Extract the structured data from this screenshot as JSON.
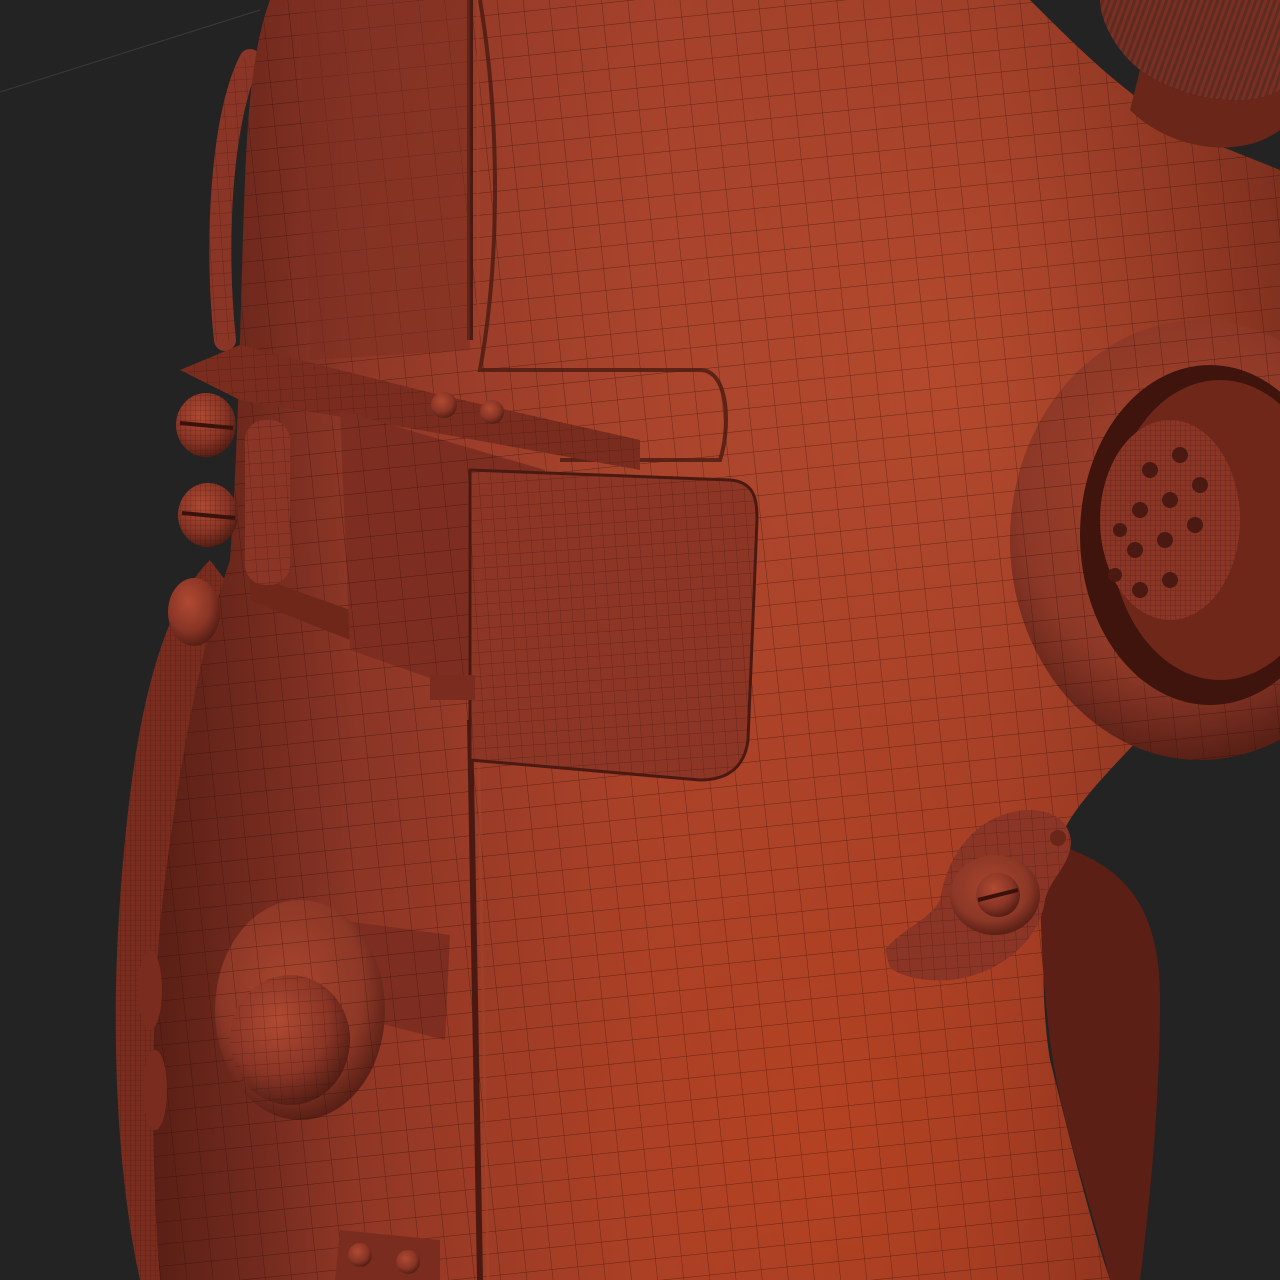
{
  "scene": {
    "colors": {
      "background": "#232323",
      "clay_base": "#8a3526",
      "clay_highlight": "#b5482e",
      "clay_shadow": "#4a1a12",
      "wire": "#2a0c07"
    },
    "objects": [
      "device-body",
      "top-knob",
      "latch-clasp",
      "screw-heads",
      "speaker-grille-ring",
      "side-crank-lever",
      "round-push-button",
      "left-strap",
      "bottom-connector"
    ]
  }
}
